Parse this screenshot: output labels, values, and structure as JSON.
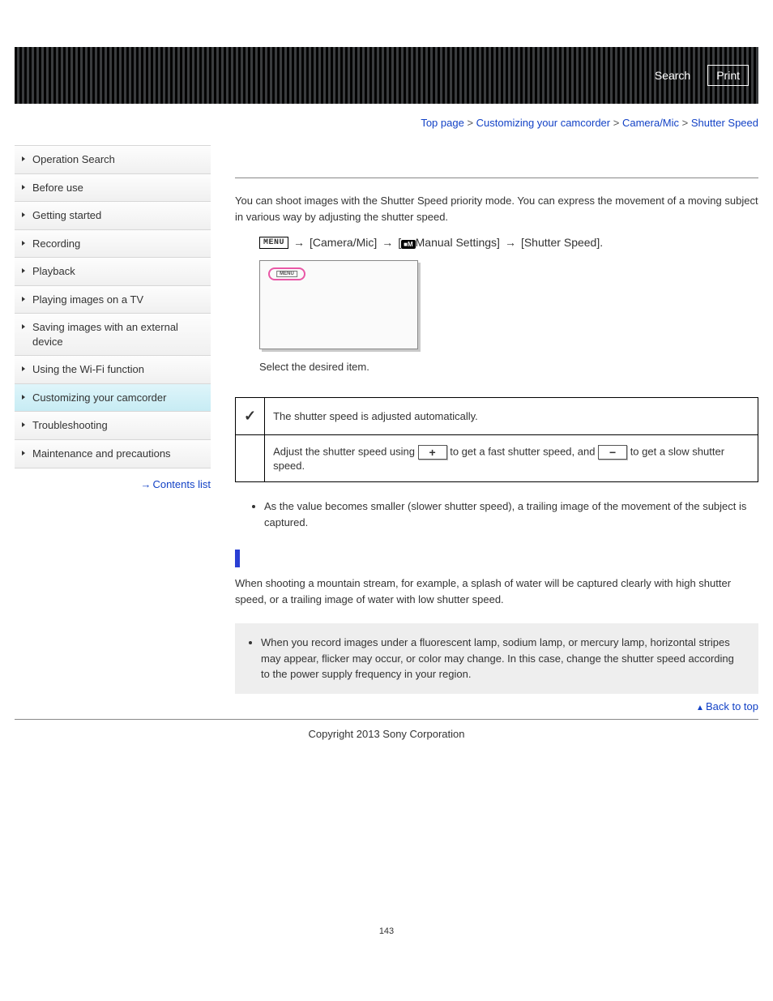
{
  "header": {
    "search": "Search",
    "print": "Print"
  },
  "breadcrumb": {
    "top": "Top page",
    "b1": "Customizing your camcorder",
    "b2": "Camera/Mic",
    "b3": "Shutter Speed",
    "sep": ">"
  },
  "sidebar": {
    "items": [
      "Operation Search",
      "Before use",
      "Getting started",
      "Recording",
      "Playback",
      "Playing images on a TV",
      "Saving images with an external device",
      "Using the Wi-Fi function",
      "Customizing your camcorder",
      "Troubleshooting",
      "Maintenance and precautions"
    ],
    "contents": "Contents list"
  },
  "main": {
    "intro": "You can shoot images with the Shutter Speed priority mode. You can express the movement of a moving subject in various way by adjusting the shutter speed.",
    "menu_label": "MENU",
    "path_cam": "[Camera/Mic]",
    "path_manual": "Manual Settings]",
    "path_shutter": "[Shutter Speed].",
    "select_caption": "Select the desired item.",
    "row1_desc": "The shutter speed is adjusted automatically.",
    "row2_a": "Adjust the shutter speed using ",
    "row2_b": " to get a fast shutter speed, and ",
    "row2_c": " to get a slow shutter speed.",
    "bullet1": "As the value becomes smaller (slower shutter speed), a trailing image of the movement of the subject is captured.",
    "hint_body": "When shooting a mountain stream, for example, a splash of water will be captured clearly with high shutter speed, or a trailing image of water with low shutter speed.",
    "note1": "When you record images under a fluorescent lamp, sodium lamp, or mercury lamp, horizontal stripes may appear, flicker may occur, or color may change. In this case, change the shutter speed according to the power supply frequency in your region.",
    "backtop": "Back to top",
    "copyright": "Copyright 2013 Sony Corporation",
    "pagenum": "143"
  }
}
